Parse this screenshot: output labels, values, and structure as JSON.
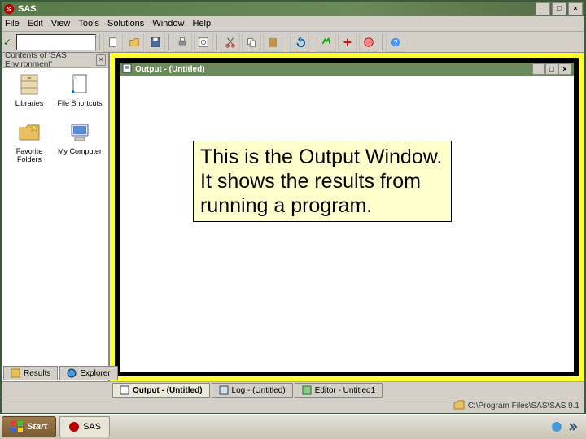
{
  "app": {
    "title": "SAS"
  },
  "menu": [
    "File",
    "Edit",
    "View",
    "Tools",
    "Solutions",
    "Window",
    "Help"
  ],
  "explorer": {
    "pane_title": "Explorer",
    "header": "Contents of 'SAS Environment'",
    "items": [
      {
        "label": "Libraries",
        "icon": "cabinet"
      },
      {
        "label": "File Shortcuts",
        "icon": "file"
      },
      {
        "label": "Favorite Folders",
        "icon": "folder"
      },
      {
        "label": "My Computer",
        "icon": "computer"
      }
    ]
  },
  "output_window": {
    "title": "Output - (Untitled)"
  },
  "callout": {
    "text": "This is the Output Window.  It shows the results from running a program."
  },
  "mdi_tabs": [
    {
      "label": "Output - (Untitled)",
      "active": true
    },
    {
      "label": "Log - (Untitled)",
      "active": false
    },
    {
      "label": "Editor - Untitled1",
      "active": false
    }
  ],
  "bottom_tabs": [
    {
      "label": "Results"
    },
    {
      "label": "Explorer"
    }
  ],
  "status": {
    "path": "C:\\Program Files\\SAS\\SAS 9.1"
  },
  "taskbar": {
    "start": "Start",
    "task": "SAS"
  }
}
